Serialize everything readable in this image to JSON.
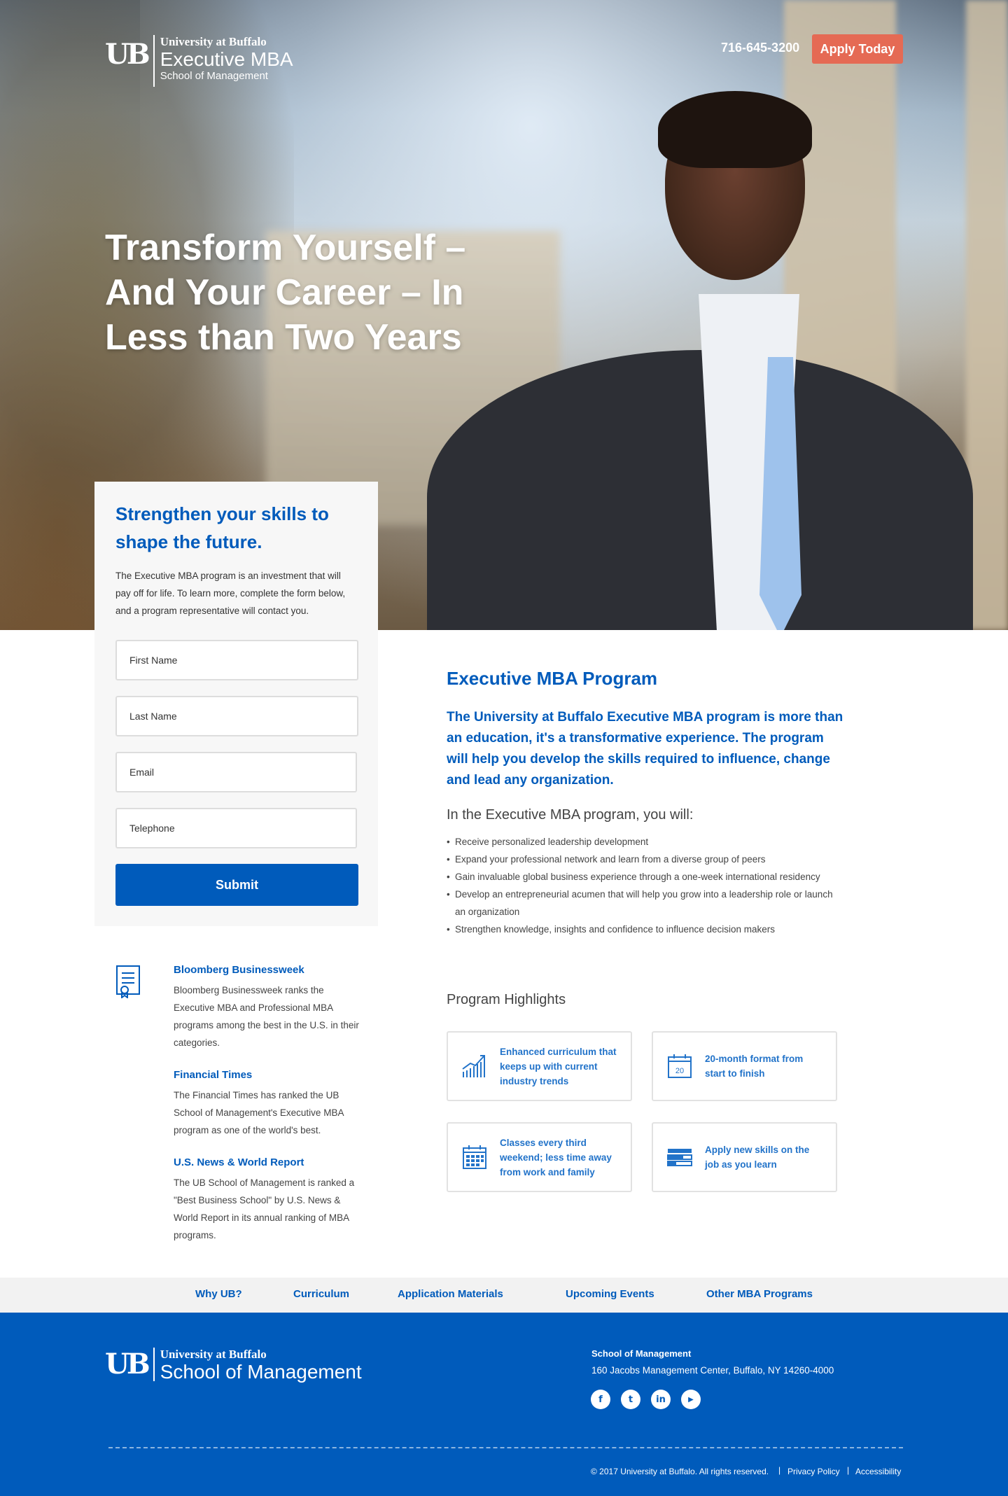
{
  "header": {
    "logo": {
      "university": "University at Buffalo",
      "program": "Executive MBA",
      "school": "School of Management"
    },
    "phone": "716-645-3200",
    "apply_label": "Apply Today"
  },
  "hero": {
    "headline": "Transform Yourself – And Your Career – In Less than Two Years"
  },
  "form": {
    "heading": "Strengthen your skills to shape the future.",
    "intro": "The Executive MBA program is an investment that will pay off for life. To learn more, complete the form below, and a program representative will contact you.",
    "fields": {
      "first_name": "First Name",
      "last_name": "Last Name",
      "email": "Email",
      "telephone": "Telephone"
    },
    "submit_label": "Submit"
  },
  "rankings": [
    {
      "title": "Bloomberg Businessweek",
      "text": "Bloomberg Businessweek ranks the Executive MBA and Professional MBA programs among the best in the U.S. in their categories."
    },
    {
      "title": "Financial Times",
      "text": "The Financial Times has ranked the UB School of Management's Executive MBA program as one of the world's best."
    },
    {
      "title": "U.S. News & World Report",
      "text": "The UB School of Management is ranked a \"Best Business School\" by U.S. News & World Report in its annual ranking of MBA programs."
    }
  ],
  "program": {
    "title": "Executive MBA Program",
    "lead": "The University at Buffalo Executive MBA program is more than an education, it's a transformative experience. The program will help you develop the skills required to influence, change and lead any organization.",
    "subheading": "In the Executive MBA program, you will:",
    "bullets": [
      "Receive personalized leadership development",
      "Expand your professional network and learn from a diverse group of peers",
      "Gain invaluable global business experience through a one-week international residency",
      "Develop an entrepreneurial acumen that will help you grow into a leadership role or launch an organization",
      "Strengthen knowledge, insights and confidence to influence decision makers"
    ],
    "highlights_title": "Program Highlights",
    "highlights": [
      {
        "icon": "chart-growth-icon",
        "text": "Enhanced curriculum that keeps up with current industry trends"
      },
      {
        "icon": "calendar-20-icon",
        "text": "20-month format from start to finish",
        "calendar_day": "20"
      },
      {
        "icon": "calendar-grid-icon",
        "text": "Classes every third weekend; less time away from work and family"
      },
      {
        "icon": "skills-bars-icon",
        "text": "Apply new skills on the job as you learn"
      }
    ]
  },
  "nav": [
    "Why UB?",
    "Curriculum",
    "Application Materials",
    "Upcoming Events",
    "Other MBA Programs"
  ],
  "footer": {
    "logo": {
      "university": "University at Buffalo",
      "school": "School of Management"
    },
    "address_heading": "School of Management",
    "address": "160 Jacobs Management Center, Buffalo, NY 14260-4000",
    "social": [
      {
        "icon": "facebook-icon",
        "glyph": "f"
      },
      {
        "icon": "twitter-icon",
        "glyph": "t"
      },
      {
        "icon": "linkedin-icon",
        "glyph": "in"
      },
      {
        "icon": "youtube-icon",
        "glyph": "▶"
      }
    ],
    "copyright": "© 2017 University at Buffalo. All rights reserved.",
    "privacy": "Privacy Policy",
    "accessibility": "Accessibility"
  },
  "colors": {
    "brand_blue": "#005bbb",
    "apply_orange": "#e56a54",
    "highlight_text": "#2273c9"
  }
}
